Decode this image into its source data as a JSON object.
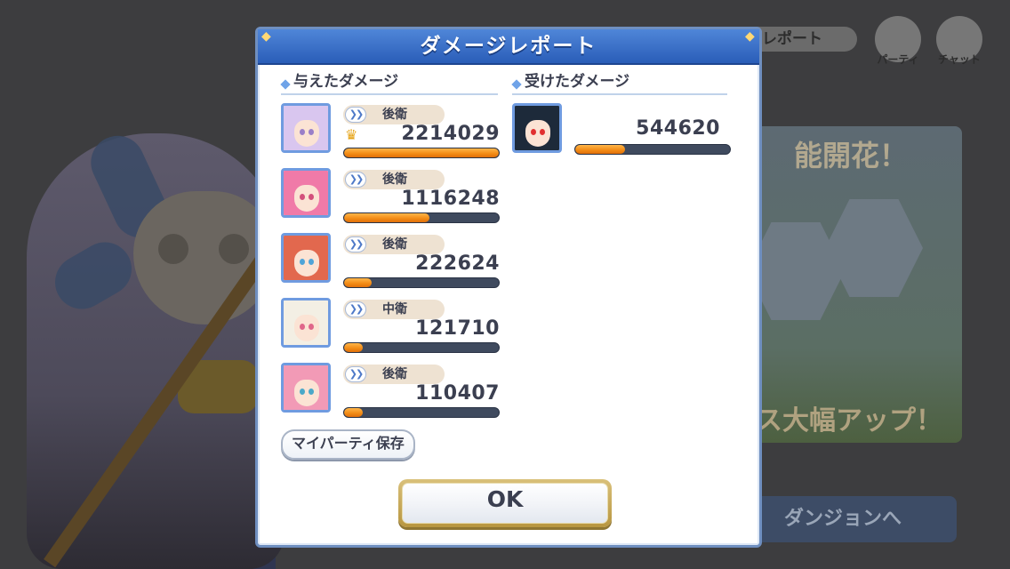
{
  "background": {
    "top_button_label": "ジレポート",
    "party_label": "パーティ",
    "chat_label": "チャット",
    "banner_top_text": "能開花！",
    "banner_bottom_text": "ス大幅アップ！",
    "dungeon_button_label": "ダンジョンへ"
  },
  "dialog": {
    "title": "ダメージレポート",
    "dealt": {
      "title": "与えたダメージ",
      "rows": [
        {
          "position": "後衛",
          "damage": "2214029",
          "top": true,
          "ratio": 1.0,
          "hair": "#d9c6ef",
          "eye": "#9a7fc8"
        },
        {
          "position": "後衛",
          "damage": "1116248",
          "top": false,
          "ratio": 0.55,
          "hair": "#f07aa8",
          "eye": "#d3507c"
        },
        {
          "position": "後衛",
          "damage": "222624",
          "top": false,
          "ratio": 0.18,
          "hair": "#e2684e",
          "eye": "#4fa4d8"
        },
        {
          "position": "中衛",
          "damage": "121710",
          "top": false,
          "ratio": 0.12,
          "hair": "#f3efe4",
          "eye": "#e0668a"
        },
        {
          "position": "後衛",
          "damage": "110407",
          "top": false,
          "ratio": 0.12,
          "hair": "#f29ab6",
          "eye": "#4aa8c8"
        }
      ]
    },
    "received": {
      "title": "受けたダメージ",
      "rows": [
        {
          "damage": "544620",
          "ratio": 0.32,
          "hair": "#1d2a3a",
          "eye": "#e13030"
        }
      ]
    },
    "save_party_label": "マイパーティ保存",
    "ok_label": "OK"
  },
  "icons": {
    "crown": "crown-icon",
    "chevron": "double-chevron-icon",
    "party": "party-icon",
    "chat": "chat-icon"
  },
  "colors": {
    "header": "#2a5db8",
    "bar_fill": "#f28a14",
    "bar_track": "#3f4a5e"
  }
}
